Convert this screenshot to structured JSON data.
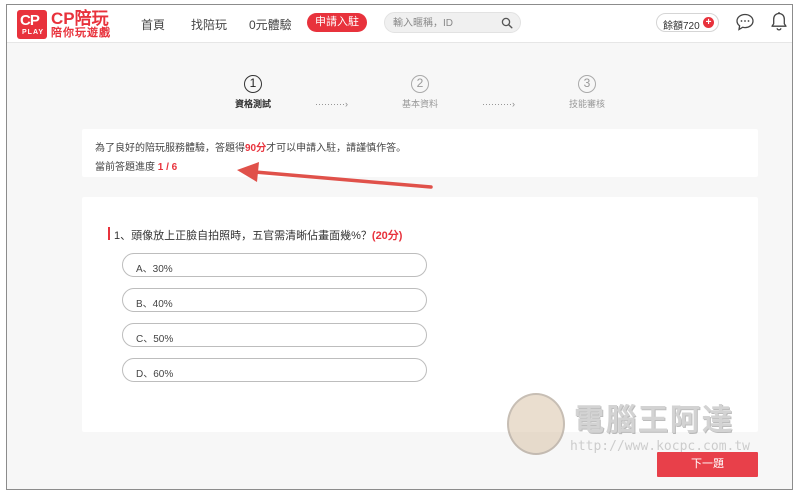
{
  "header": {
    "logo": {
      "badge": "CP",
      "badge_sub": "PLAY",
      "title": "CP陪玩",
      "subtitle": "陪你玩遊戲"
    },
    "nav": [
      {
        "label": "首頁"
      },
      {
        "label": "找陪玩"
      },
      {
        "label": "0元體驗"
      }
    ],
    "cta_label": "申請入駐",
    "search": {
      "placeholder": "輸入暱稱，ID",
      "icon": "search-icon"
    },
    "balance": {
      "label": "餘額720",
      "plus": "+"
    },
    "icons": [
      "chat-icon",
      "bell-icon"
    ]
  },
  "steps": [
    {
      "number": "1",
      "label": "資格測試",
      "active": true
    },
    {
      "number": "2",
      "label": "基本資料",
      "active": false
    },
    {
      "number": "3",
      "label": "技能審核",
      "active": false
    }
  ],
  "step_connector": "··········›",
  "notice": {
    "line1_prefix": "為了良好的陪玩服務體驗，答題得",
    "line1_highlight": "90分",
    "line1_suffix": "才可以申請入駐，請謹慎作答。",
    "line2_prefix": "當前答題進度 ",
    "line2_highlight": "1 / 6"
  },
  "annotation_arrow_color": "#e0514a",
  "question": {
    "text": "1、頭像放上正臉自拍照時，五官需清晰佔畫面幾%？",
    "points": "(20分)",
    "options": [
      {
        "label": "A、30%"
      },
      {
        "label": "B、40%"
      },
      {
        "label": "C、50%"
      },
      {
        "label": "D、60%"
      }
    ]
  },
  "next_button_label": "下一題",
  "watermark": {
    "title": "電腦王阿達",
    "url": "http://www.kocpc.com.tw"
  },
  "colors": {
    "brand": "#e8323c",
    "background": "#f7f7f7"
  }
}
